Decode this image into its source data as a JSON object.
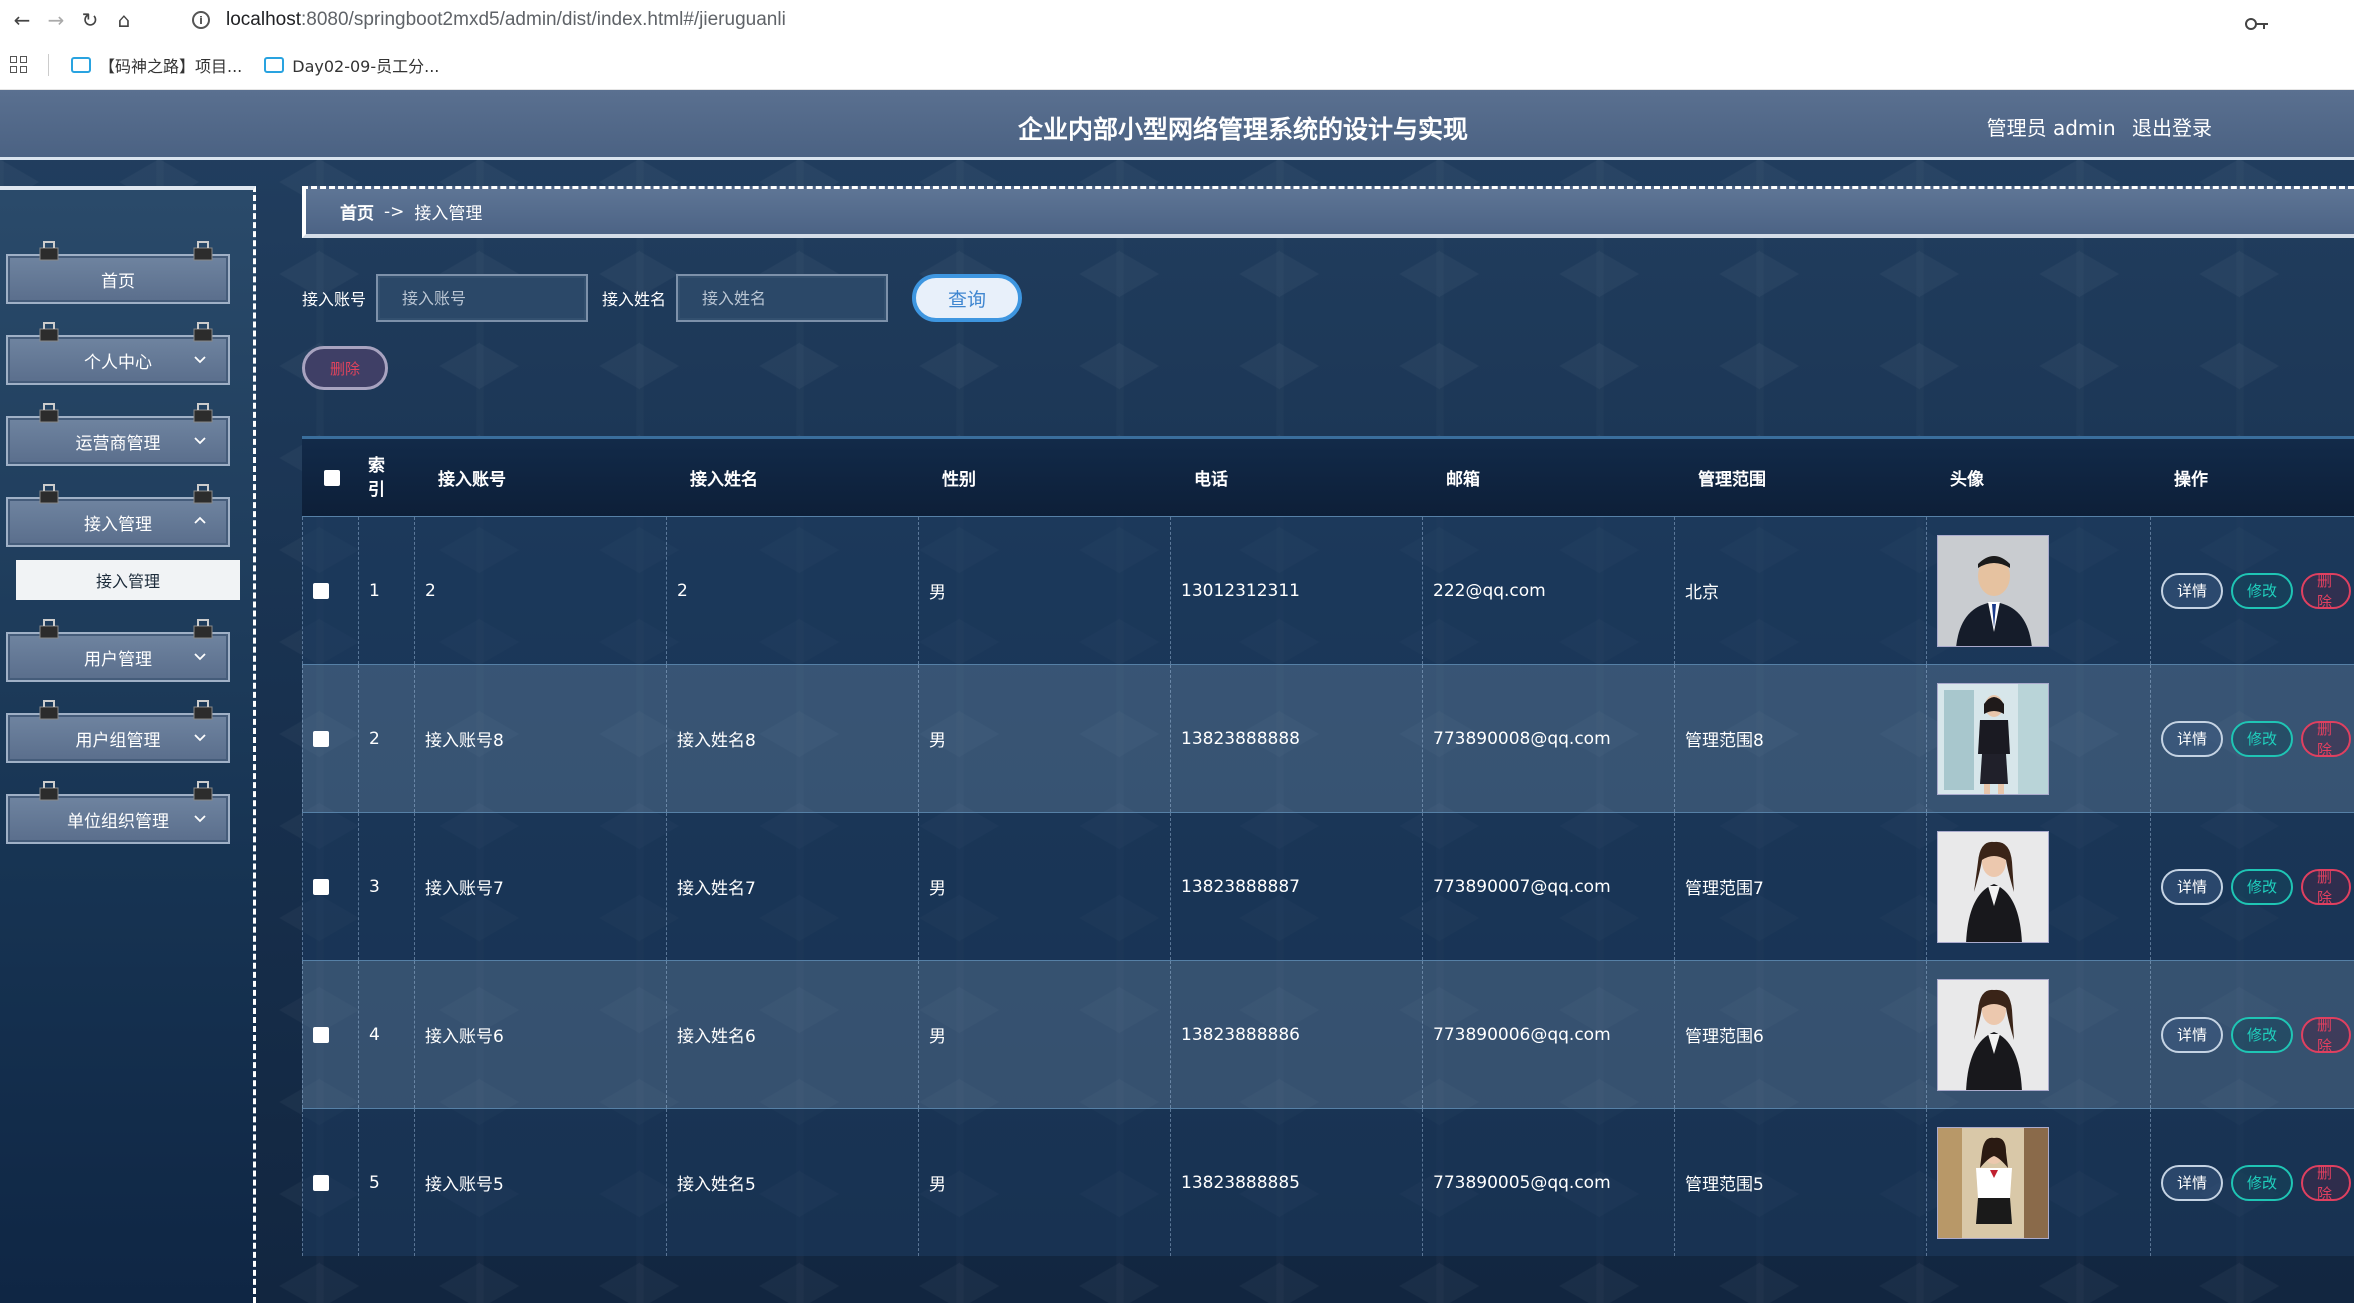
{
  "browser": {
    "url_host": "localhost",
    "url_path": ":8080/springboot2mxd5/admin/dist/index.html#/jieruguanli",
    "bookmarks": [
      "【码神之路】项目...",
      "Day02-09-员工分..."
    ]
  },
  "header": {
    "title": "企业内部小型网络管理系统的设计与实现",
    "user_label": "管理员 admin",
    "logout_label": "退出登录"
  },
  "sidebar": {
    "items": [
      {
        "label": "首页"
      },
      {
        "label": "个人中心"
      },
      {
        "label": "运营商管理"
      },
      {
        "label": "接入管理"
      },
      {
        "label": "用户管理"
      },
      {
        "label": "用户组管理"
      },
      {
        "label": "单位组织管理"
      }
    ],
    "active_sub": "接入管理"
  },
  "breadcrumb": {
    "home": "首页",
    "separator": "->",
    "current": "接入管理"
  },
  "search": {
    "account_label": "接入账号",
    "account_placeholder": "接入账号",
    "name_label": "接入姓名",
    "name_placeholder": "接入姓名",
    "query_button": "查询"
  },
  "actions": {
    "delete_button": "删除"
  },
  "table": {
    "headers": [
      "索引",
      "接入账号",
      "接入姓名",
      "性别",
      "电话",
      "邮箱",
      "管理范围",
      "头像",
      "操作"
    ],
    "rows": [
      {
        "index": "1",
        "account": "2",
        "name": "2",
        "gender": "男",
        "phone": "13012312311",
        "email": "222@qq.com",
        "scope": "北京",
        "avatar": "male-suit-portrait"
      },
      {
        "index": "2",
        "account": "接入账号8",
        "name": "接入姓名8",
        "gender": "男",
        "phone": "13823888888",
        "email": "773890008@qq.com",
        "scope": "管理范围8",
        "avatar": "female-office-portrait"
      },
      {
        "index": "3",
        "account": "接入账号7",
        "name": "接入姓名7",
        "gender": "男",
        "phone": "13823888887",
        "email": "773890007@qq.com",
        "scope": "管理范围7",
        "avatar": "female-suit-portrait"
      },
      {
        "index": "4",
        "account": "接入账号6",
        "name": "接入姓名6",
        "gender": "男",
        "phone": "13823888886",
        "email": "773890006@qq.com",
        "scope": "管理范围6",
        "avatar": "female-suit-portrait"
      },
      {
        "index": "5",
        "account": "接入账号5",
        "name": "接入姓名5",
        "gender": "男",
        "phone": "13823888885",
        "email": "773890005@qq.com",
        "scope": "管理范围5",
        "avatar": "female-uniform-portrait"
      }
    ],
    "row_actions": {
      "detail": "详情",
      "edit": "修改",
      "delete": "删除"
    }
  },
  "colors": {
    "accent_blue": "#3e96e0",
    "edit_teal": "#1fc5b4",
    "delete_red": "#e04060",
    "header_bar": "#4b6283"
  }
}
